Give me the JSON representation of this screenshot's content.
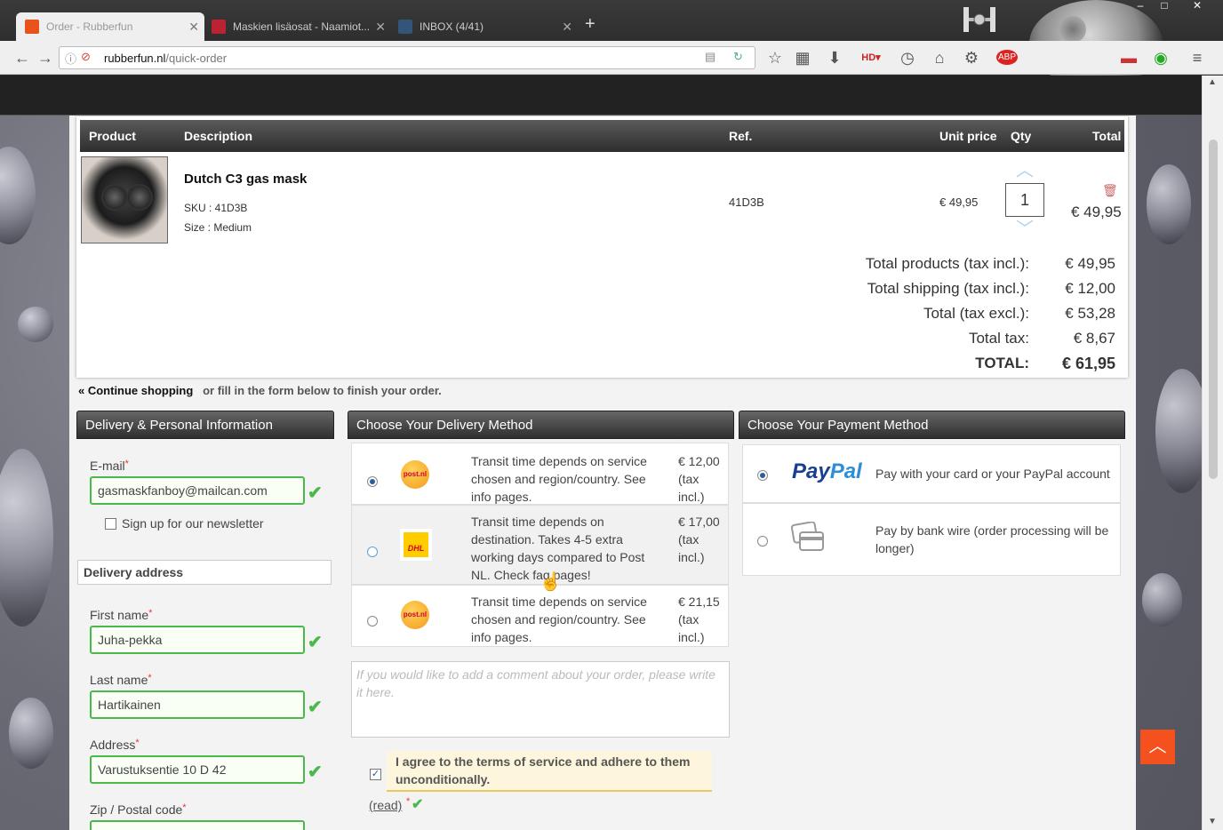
{
  "browser": {
    "tabs": [
      {
        "title": "Order - Rubberfun",
        "active": true,
        "favicon_color": "#e8531a"
      },
      {
        "title": "Maskien lisäosat - Naamiot...",
        "active": false,
        "favicon_color": "#b23"
      },
      {
        "title": "INBOX (4/41)",
        "active": false,
        "favicon_color": "#357"
      }
    ],
    "new_tab": "+",
    "url_domain": "rubberfun.nl",
    "url_path": "/quick-order",
    "window_controls": [
      "–",
      "□",
      "✕"
    ],
    "toolbar_icons": [
      "reader-view-icon",
      "reload-icon",
      "bookmark-star-icon",
      "bookmarks-list-icon",
      "download-icon",
      "hd-icon",
      "history-icon",
      "home-icon",
      "settings-icon",
      "adblock-icon",
      "extension-icon",
      "menu-icon"
    ]
  },
  "cart": {
    "headers": {
      "product": "Product",
      "description": "Description",
      "ref": "Ref.",
      "unit_price": "Unit price",
      "qty": "Qty",
      "total": "Total"
    },
    "item": {
      "name": "Dutch C3 gas mask",
      "sku": "SKU : 41D3B",
      "size": "Size : Medium",
      "ref": "41D3B",
      "unit_price": "€ 49,95",
      "qty": "1",
      "total": "€ 49,95"
    },
    "summary": [
      {
        "label": "Total products (tax incl.):",
        "value": "€ 49,95"
      },
      {
        "label": "Total shipping (tax incl.):",
        "value": "€ 12,00"
      },
      {
        "label": "Total (tax excl.):",
        "value": "€ 53,28"
      },
      {
        "label": "Total tax:",
        "value": "€ 8,67"
      },
      {
        "label": "TOTAL:",
        "value": "€ 61,95"
      }
    ],
    "continue_link": "« Continue shopping",
    "continue_suffix": "or fill in the form below to finish your order."
  },
  "personal": {
    "title": "Delivery & Personal Information",
    "email_label": "E-mail",
    "email_value": "gasmaskfanboy@mailcan.com",
    "newsletter_label": "Sign up for our newsletter",
    "delivery_address": "Delivery address",
    "first_name_label": "First name",
    "first_name_value": "Juha-pekka",
    "last_name_label": "Last name",
    "last_name_value": "Hartikainen",
    "address_label": "Address",
    "address_value": "Varustuksentie 10 D 42",
    "zip_label": "Zip / Postal code",
    "required_mark": "*"
  },
  "delivery": {
    "title": "Choose Your Delivery Method",
    "options": [
      {
        "carrier": "post.nl",
        "text": "Transit time depends on service chosen and region/country. See info pages.",
        "price_lines": [
          "€ 12,00",
          "(tax",
          "incl.)"
        ],
        "selected": true
      },
      {
        "carrier": "DHL",
        "text": "Transit time depends on destination. Takes 4-5 extra working days compared to Post NL. Check faq pages!",
        "price_lines": [
          "€ 17,00",
          "(tax",
          "incl.)"
        ],
        "selected": false
      },
      {
        "carrier": "post.nl",
        "text": "Transit time depends on service chosen and region/country. See info pages.",
        "price_lines": [
          "€ 21,15",
          "(tax",
          "incl.)"
        ],
        "selected": false
      }
    ],
    "comment_placeholder": "If you would like to add a comment about your order, please write it here.",
    "agree_text": "I agree to the terms of service and adhere to them unconditionally.",
    "read_link": "(read)",
    "agree_checked": true
  },
  "payment": {
    "title": "Choose Your Payment Method",
    "options": [
      {
        "logo_a": "Pay",
        "logo_b": "Pal",
        "text": "Pay with your card or your PayPal account",
        "selected": true
      },
      {
        "text": "Pay by bank wire (order processing will be longer)",
        "selected": false
      }
    ]
  },
  "colors": {
    "valid_green": "#4bb84b",
    "accent_orange": "#f4511e",
    "header_dark": "#2e2e2e"
  }
}
